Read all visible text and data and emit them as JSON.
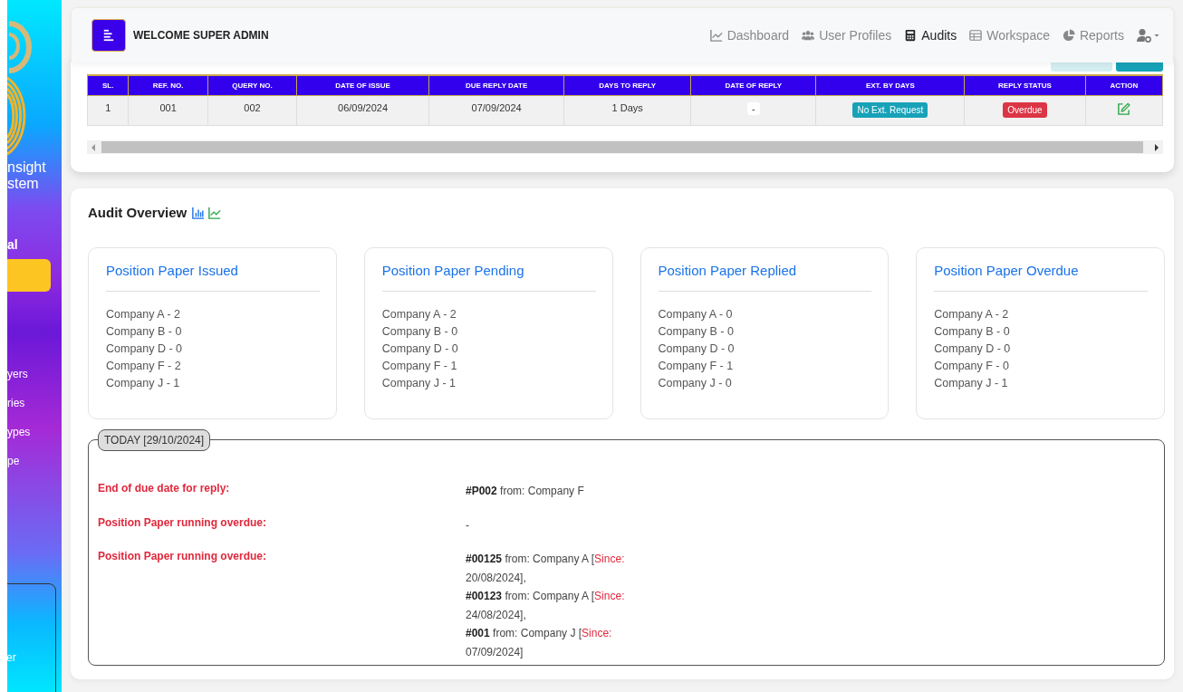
{
  "sidebar": {
    "brand_lines": [
      "nsight",
      "stem"
    ],
    "section_label": "al",
    "items": [
      {
        "label": "yers"
      },
      {
        "label": "ries"
      },
      {
        "label": "ypes"
      },
      {
        "label": "pe"
      }
    ],
    "footer_label": "er"
  },
  "header": {
    "title": "WELCOME SUPER ADMIN",
    "nav": [
      {
        "label": "Dashboard",
        "selected": false
      },
      {
        "label": "User Profiles",
        "selected": false
      },
      {
        "label": "Audits",
        "selected": true
      },
      {
        "label": "Workspace",
        "selected": false
      },
      {
        "label": "Reports",
        "selected": false
      }
    ]
  },
  "table": {
    "columns": [
      "SL.",
      "REF. NO.",
      "QUERY NO.",
      "DATE OF ISSUE",
      "DUE REPLY DATE",
      "DAYS TO REPLY",
      "DATE OF REPLY",
      "EXT. BY DAYS",
      "REPLY STATUS",
      "ACTION"
    ],
    "rows": [
      {
        "cells": [
          {
            "kind": "text",
            "text": "1"
          },
          {
            "kind": "text",
            "text": "001"
          },
          {
            "kind": "text",
            "text": "002"
          },
          {
            "kind": "text",
            "text": "06/09/2024"
          },
          {
            "kind": "text",
            "text": "07/09/2024"
          },
          {
            "kind": "text",
            "text": "1 Days"
          },
          {
            "kind": "chip",
            "text": "-"
          },
          {
            "kind": "badge",
            "text": "No Ext. Request",
            "color": "#17a2b8"
          },
          {
            "kind": "badge",
            "text": "Overdue",
            "color": "#dc3545"
          },
          {
            "kind": "edit"
          }
        ]
      }
    ]
  },
  "overview": {
    "title": "Audit Overview",
    "cards": [
      {
        "title": "Position Paper Issued",
        "lines": [
          "Company A - 2",
          "Company B - 0",
          "Company D - 0",
          "Company F - 2",
          "Company J - 1"
        ]
      },
      {
        "title": "Position Paper Pending",
        "lines": [
          "Company A - 2",
          "Company B - 0",
          "Company D - 0",
          "Company F - 1",
          "Company J - 1"
        ]
      },
      {
        "title": "Position Paper Replied",
        "lines": [
          "Company A - 0",
          "Company B - 0",
          "Company D - 0",
          "Company F - 1",
          "Company J - 0"
        ]
      },
      {
        "title": "Position Paper Overdue",
        "lines": [
          "Company A - 2",
          "Company B - 0",
          "Company D - 0",
          "Company F - 0",
          "Company J - 1"
        ]
      }
    ]
  },
  "today": {
    "legend": "TODAY [29/10/2024]",
    "rows": [
      {
        "label": "End of due date for reply:",
        "entries": [
          {
            "ref": "#P002",
            "from": "from: Company F"
          }
        ]
      },
      {
        "label": "Position Paper running overdue:",
        "entries": [
          {
            "text": "-"
          }
        ]
      },
      {
        "label": "Position Paper running overdue:",
        "entries": [
          {
            "ref": "#00125",
            "from": "from: Company A [",
            "since": "Since:",
            "date": "20/08/2024],"
          },
          {
            "ref": "#00123",
            "from": "from: Company A [",
            "since": "Since:",
            "date": "24/08/2024],"
          },
          {
            "ref": "#001",
            "from": "from: Company J [",
            "since": "Since:",
            "date": "07/09/2024]"
          }
        ]
      }
    ]
  }
}
